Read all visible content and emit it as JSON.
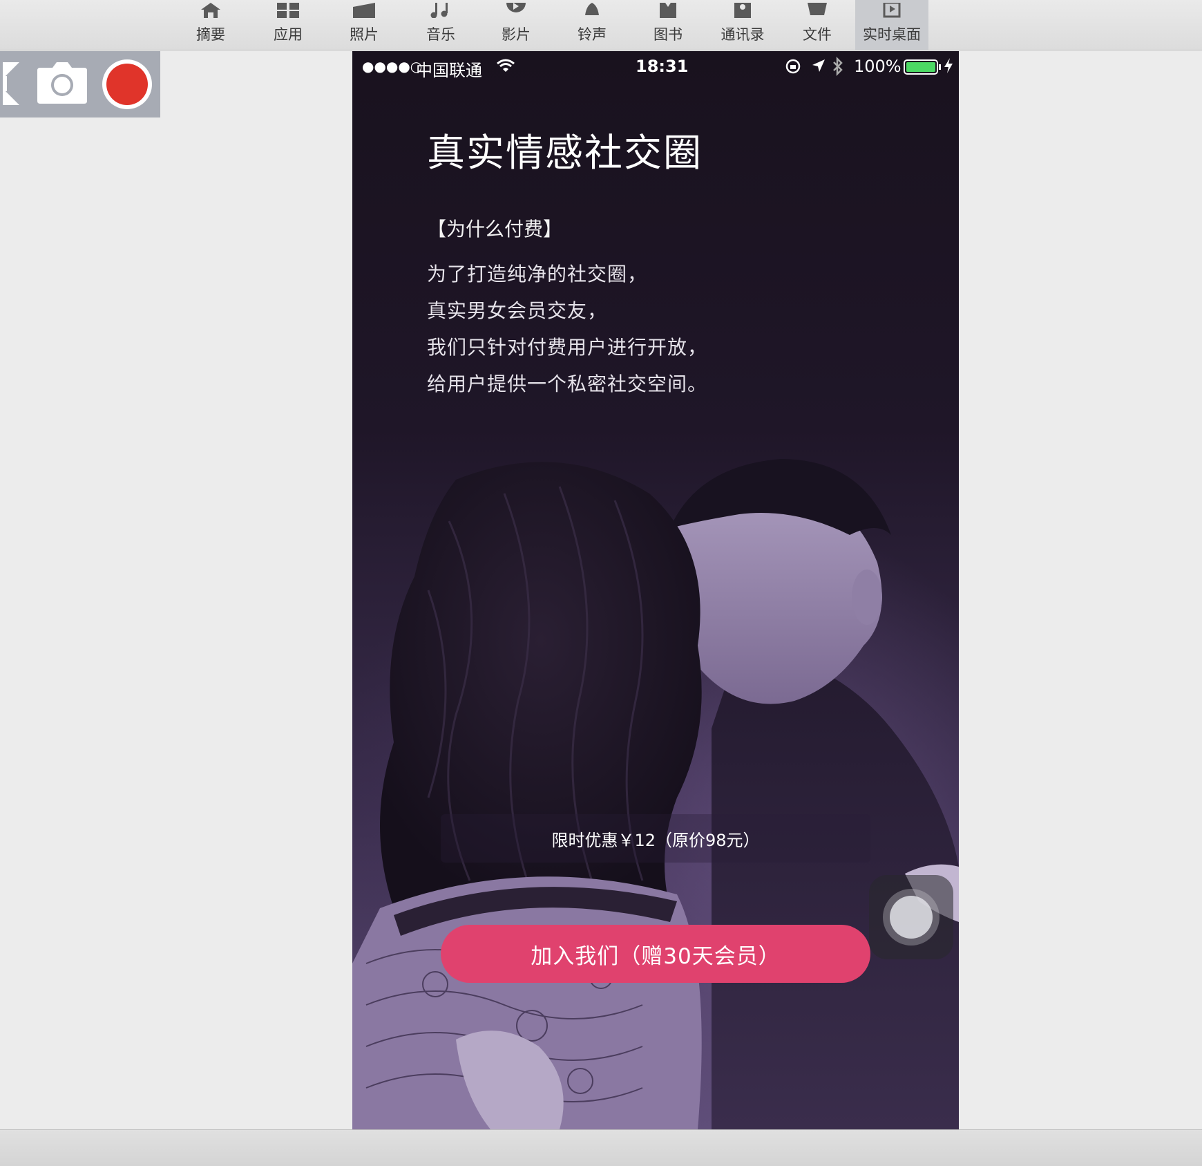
{
  "toolbar": {
    "tabs": [
      {
        "label": "摘要",
        "icon": "home-icon"
      },
      {
        "label": "应用",
        "icon": "apps-icon"
      },
      {
        "label": "照片",
        "icon": "photo-icon"
      },
      {
        "label": "音乐",
        "icon": "music-icon"
      },
      {
        "label": "影片",
        "icon": "video-icon"
      },
      {
        "label": "铃声",
        "icon": "bell-icon"
      },
      {
        "label": "图书",
        "icon": "book-icon"
      },
      {
        "label": "通讯录",
        "icon": "contacts-icon"
      },
      {
        "label": "文件",
        "icon": "folder-icon"
      },
      {
        "label": "实时桌面",
        "icon": "live-desktop-icon"
      }
    ],
    "active_tab": "实时桌面"
  },
  "capture_controls": {
    "icons": [
      "fullscreen-icon",
      "camera-icon",
      "record-icon"
    ],
    "record_color": "#e0342a"
  },
  "phone": {
    "status": {
      "signal": "●●●●○",
      "carrier": "中国联通",
      "time": "18:31",
      "battery": "100%",
      "battery_color": "#4cd964"
    },
    "title": "真实情感社交圈",
    "subtitle": "【为什么付费】",
    "body_lines": [
      "为了打造纯净的社交圈，",
      "真实男女会员交友，",
      "我们只针对付费用户进行开放，",
      "给用户提供一个私密社交空间。"
    ],
    "promo": "限时优惠￥12（原价98元）",
    "join_button": "加入我们（赠30天会员）",
    "accent_color": "#e0426e"
  }
}
